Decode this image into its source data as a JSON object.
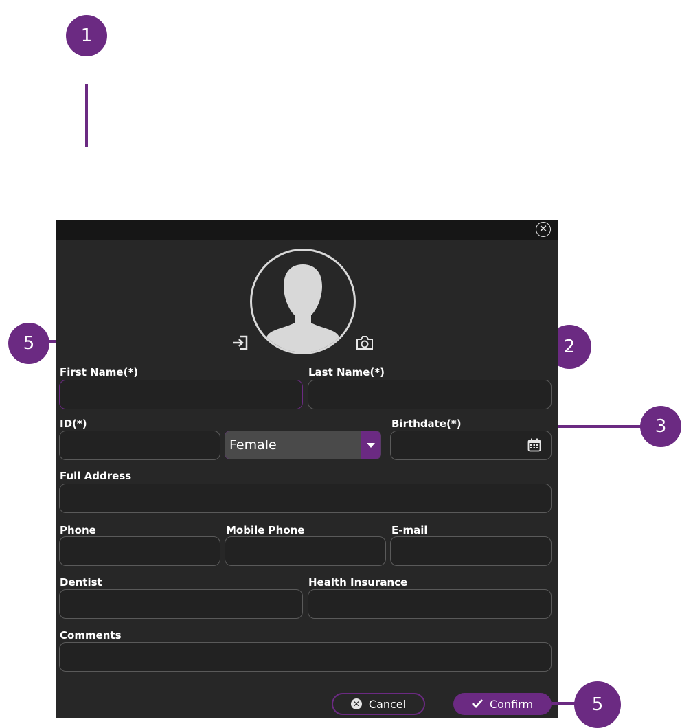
{
  "callouts": [
    "1",
    "2",
    "3",
    "5",
    "5"
  ],
  "dialog": {
    "labels": {
      "first_name": "First Name(*)",
      "last_name": "Last Name(*)",
      "id": "ID(*)",
      "birthdate": "Birthdate(*)",
      "full_address": "Full Address",
      "phone": "Phone",
      "mobile_phone": "Mobile Phone",
      "email": "E-mail",
      "dentist": "Dentist",
      "health_insurance": "Health Insurance",
      "comments": "Comments"
    },
    "gender": {
      "selected": "Female"
    },
    "buttons": {
      "cancel": "Cancel",
      "confirm": "Confirm"
    },
    "icons": [
      "close-icon",
      "import-icon",
      "camera-icon",
      "calendar-icon",
      "dropdown-arrow-icon",
      "check-icon",
      "cancel-icon"
    ]
  },
  "colors": {
    "accent": "#6b2a82",
    "dialog_bg": "#272727",
    "titlebar_bg": "#161616"
  }
}
